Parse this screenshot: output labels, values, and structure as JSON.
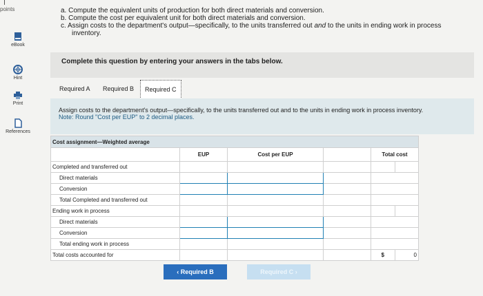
{
  "sidebar": {
    "points_label": "points",
    "items": [
      {
        "label": "eBook",
        "icon": "book-icon"
      },
      {
        "label": "Hint",
        "icon": "lifebuoy-icon"
      },
      {
        "label": "Print",
        "icon": "printer-icon"
      },
      {
        "label": "References",
        "icon": "document-icon"
      }
    ]
  },
  "tasks": {
    "a": "a. Compute the equivalent units of production for both direct materials and conversion.",
    "b": "b. Compute the cost per equivalent unit for both direct materials and conversion.",
    "c_pre": "c. Assign costs to the department's output—specifically, to the units transferred out ",
    "c_and": "and",
    "c_post": " to the units in ending work in process",
    "c_cont": "inventory."
  },
  "banner": "Complete this question by entering your answers in the tabs below.",
  "tabs": [
    "Required A",
    "Required B",
    "Required C"
  ],
  "panel": {
    "instruction": "Assign costs to the department's output—specifically, to the units transferred out and to the units in ending work in process inventory.",
    "note": "Note: Round \"Cost per EUP\" to 2 decimal places."
  },
  "table": {
    "title": "Cost assignment—Weighted average",
    "col_eup": "EUP",
    "col_cost": "Cost per EUP",
    "col_total": "Total cost",
    "rows": {
      "completed": "Completed and transferred out",
      "dm1": "Direct materials",
      "conv1": "Conversion",
      "total_completed": "Total Completed and transferred out",
      "ending": "Ending work in process",
      "dm2": "Direct materials",
      "conv2": "Conversion",
      "total_ending": "Total ending work in process",
      "total_costs": "Total costs accounted for"
    },
    "total_currency": "$",
    "total_value": "0"
  },
  "nav": {
    "prev": "‹ Required B",
    "next": "Required C ›"
  },
  "colors": {
    "accent": "#2a6ebd",
    "panel": "#dfe9ec",
    "input_border": "#1f7fb3"
  }
}
